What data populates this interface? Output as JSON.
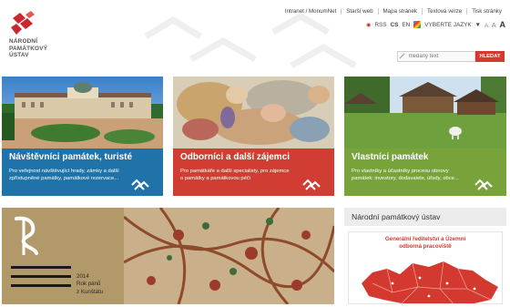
{
  "brand": {
    "logo_lines": [
      "NÁRODNÍ",
      "PAMÁTKOVÝ",
      "ÚSTAV"
    ],
    "color": "#c8282e"
  },
  "top_links": [
    "Intranet / MonumNet",
    "Starší web",
    "Mapa stránek",
    "Textová verze",
    "Tisk stránky"
  ],
  "language": {
    "rss": "RSS",
    "cs": "CS",
    "en": "EN",
    "select_label": "VYBERTE JAZYK",
    "arrow": "▼",
    "font_sizes": [
      "A",
      "A",
      "A"
    ]
  },
  "search": {
    "placeholder": "hledaný text",
    "button": "HLEDAT"
  },
  "tiles": [
    {
      "title": "Návštěvníci památek, turisté",
      "desc": "Pro veřejnost návštěvující hrady, zámky a další zpřístupněné památky, památkové rezervace...",
      "color": "#1f73a8"
    },
    {
      "title": "Odborníci a další zájemci",
      "desc": "Pro památkáře a další specialisty, pro zájemce o památky a památkovou péči",
      "color": "#d13d33"
    },
    {
      "title": "Vlastníci památek",
      "desc": "Pro vlastníky a účastníky procesu obnovy památek: investory, dodavatele, úřady, obce...",
      "color": "#77a33a"
    }
  ],
  "feature": {
    "lines": [
      "2014",
      "Rok pánů",
      "z Kunštátu"
    ]
  },
  "npu": {
    "heading": "Národní památkový ústav",
    "caption_lines": [
      "Generální ředitelství a Územní",
      "odborná pracoviště"
    ]
  }
}
